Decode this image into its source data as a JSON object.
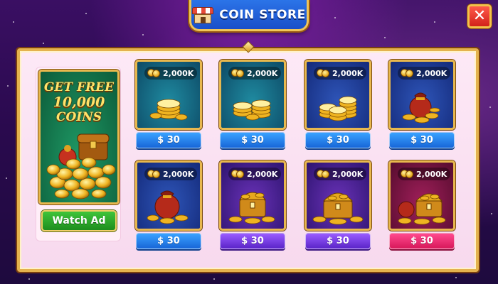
{
  "header": {
    "title": "COIN STORE",
    "store_icon": "store-icon"
  },
  "close": {
    "label": "✕"
  },
  "promo": {
    "line1": "GET FREE",
    "line2": "10,000",
    "line3": "COINS",
    "button": "Watch Ad"
  },
  "store": {
    "items": [
      {
        "amount": "2,000K",
        "price": "$ 30",
        "art": "coin-stack"
      },
      {
        "amount": "2,000K",
        "price": "$ 30",
        "art": "coin-pile"
      },
      {
        "amount": "2,000K",
        "price": "$ 30",
        "art": "coin-tower"
      },
      {
        "amount": "2,000K",
        "price": "$ 30",
        "art": "coin-sack"
      },
      {
        "amount": "2,000K",
        "price": "$ 30",
        "art": "coin-sack"
      },
      {
        "amount": "2,000K",
        "price": "$ 30",
        "art": "treasure-chest"
      },
      {
        "amount": "2,000K",
        "price": "$ 30",
        "art": "treasure-chest"
      },
      {
        "amount": "2,000K",
        "price": "$ 30",
        "art": "treasure-chest-sack"
      }
    ]
  },
  "colors": {
    "background": "#2a0a4e",
    "panel": "#fde9f6",
    "gold_border": "#e4b24e",
    "header_blue": "#2b74e8",
    "close_red": "#d2221a",
    "price_blue": "#1766d8",
    "price_purple": "#5a24c8",
    "price_pink": "#d8185a"
  }
}
